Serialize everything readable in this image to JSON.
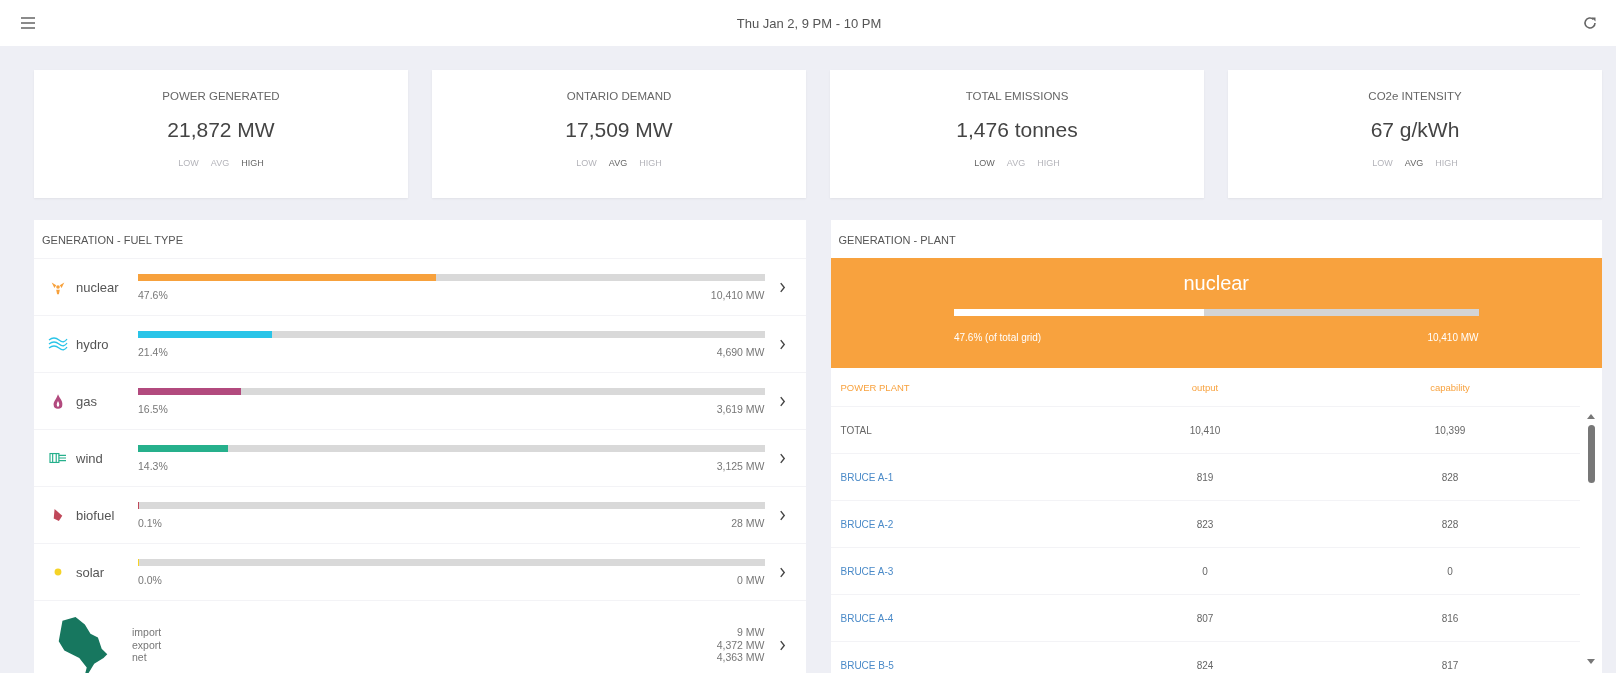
{
  "header": {
    "title": "Thu Jan 2, 9 PM - 10 PM"
  },
  "stats": [
    {
      "label": "POWER GENERATED",
      "value": "21,872 MW",
      "levels": [
        {
          "label": "LOW",
          "selected": false
        },
        {
          "label": "AVG",
          "selected": false
        },
        {
          "label": "HIGH",
          "selected": true
        }
      ]
    },
    {
      "label": "ONTARIO DEMAND",
      "value": "17,509 MW",
      "levels": [
        {
          "label": "LOW",
          "selected": false
        },
        {
          "label": "AVG",
          "selected": true
        },
        {
          "label": "HIGH",
          "selected": false
        }
      ]
    },
    {
      "label": "TOTAL EMISSIONS",
      "value": "1,476 tonnes",
      "levels": [
        {
          "label": "LOW",
          "selected": true
        },
        {
          "label": "AVG",
          "selected": false
        },
        {
          "label": "HIGH",
          "selected": false
        }
      ]
    },
    {
      "label": "CO2e INTENSITY",
      "value": "67 g/kWh",
      "levels": [
        {
          "label": "LOW",
          "selected": false
        },
        {
          "label": "AVG",
          "selected": true
        },
        {
          "label": "HIGH",
          "selected": false
        }
      ]
    }
  ],
  "fuel_panel": {
    "title": "GENERATION - FUEL TYPE",
    "rows": [
      {
        "kind": "fuel",
        "name": "nuclear",
        "level": 0.476,
        "color": "#f7a13c",
        "percent": "47.6%",
        "output": "10,410 MW"
      },
      {
        "kind": "fuel",
        "name": "hydro",
        "level": 0.214,
        "color": "#29c4e8",
        "percent": "21.4%",
        "output": "4,690 MW"
      },
      {
        "kind": "fuel",
        "name": "gas",
        "level": 0.165,
        "color": "#b24a7e",
        "percent": "16.5%",
        "output": "3,619 MW"
      },
      {
        "kind": "fuel",
        "name": "wind",
        "level": 0.143,
        "color": "#26b08c",
        "percent": "14.3%",
        "output": "3,125 MW"
      },
      {
        "kind": "fuel",
        "name": "biofuel",
        "level": 0.001,
        "color": "#c0485a",
        "percent": "0.1%",
        "output": "28 MW"
      },
      {
        "kind": "fuel",
        "name": "solar",
        "level": 0.0,
        "color": "#f5d327",
        "percent": "0.0%",
        "output": "0 MW"
      },
      {
        "kind": "trade",
        "labels": [
          "import",
          "export",
          "net"
        ],
        "values": [
          "9 MW",
          "4,372 MW",
          "4,363 MW"
        ]
      }
    ]
  },
  "plant_panel": {
    "title": "GENERATION - PLANT",
    "banner": {
      "fuel": "nuclear",
      "level": 0.476,
      "share": "47.6% (of total grid)",
      "output": "10,410 MW"
    },
    "columns": [
      "POWER PLANT",
      "output",
      "capability"
    ],
    "rows": [
      {
        "kind": "total",
        "plant": "TOTAL",
        "output": "10,410",
        "capability": "10,399"
      },
      {
        "kind": "plant",
        "plant": "BRUCE A-1",
        "output": "819",
        "capability": "828"
      },
      {
        "kind": "plant",
        "plant": "BRUCE A-2",
        "output": "823",
        "capability": "828"
      },
      {
        "kind": "plant",
        "plant": "BRUCE A-3",
        "output": "0",
        "capability": "0"
      },
      {
        "kind": "plant",
        "plant": "BRUCE A-4",
        "output": "807",
        "capability": "816"
      },
      {
        "kind": "plant",
        "plant": "BRUCE B-5",
        "output": "824",
        "capability": "817"
      }
    ]
  }
}
